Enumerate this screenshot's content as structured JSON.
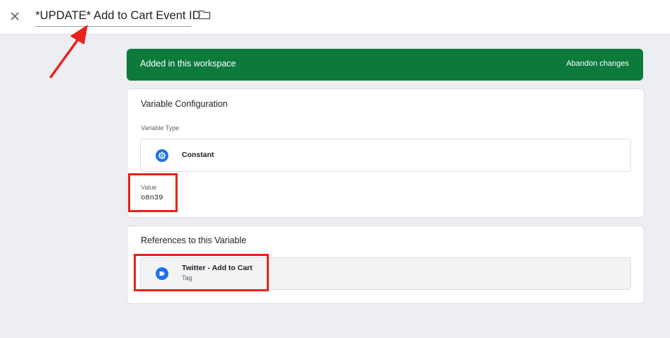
{
  "header": {
    "title": "*UPDATE* Add to Cart Event ID",
    "close_icon": "close-icon",
    "folder_icon": "folder-icon"
  },
  "banner": {
    "text": "Added in this workspace",
    "action": "Abandon changes",
    "color": "#0b7a3b"
  },
  "config": {
    "title": "Variable Configuration",
    "type_label": "Variable Type",
    "type_name": "Constant",
    "type_icon": "gear-icon",
    "value_label": "Value",
    "value": "o8n39"
  },
  "references": {
    "title": "References to this Variable",
    "items": [
      {
        "name": "Twitter - Add to Cart",
        "kind": "Tag",
        "icon": "tag-icon"
      }
    ]
  },
  "annotations": {
    "color": "#e8221b"
  }
}
